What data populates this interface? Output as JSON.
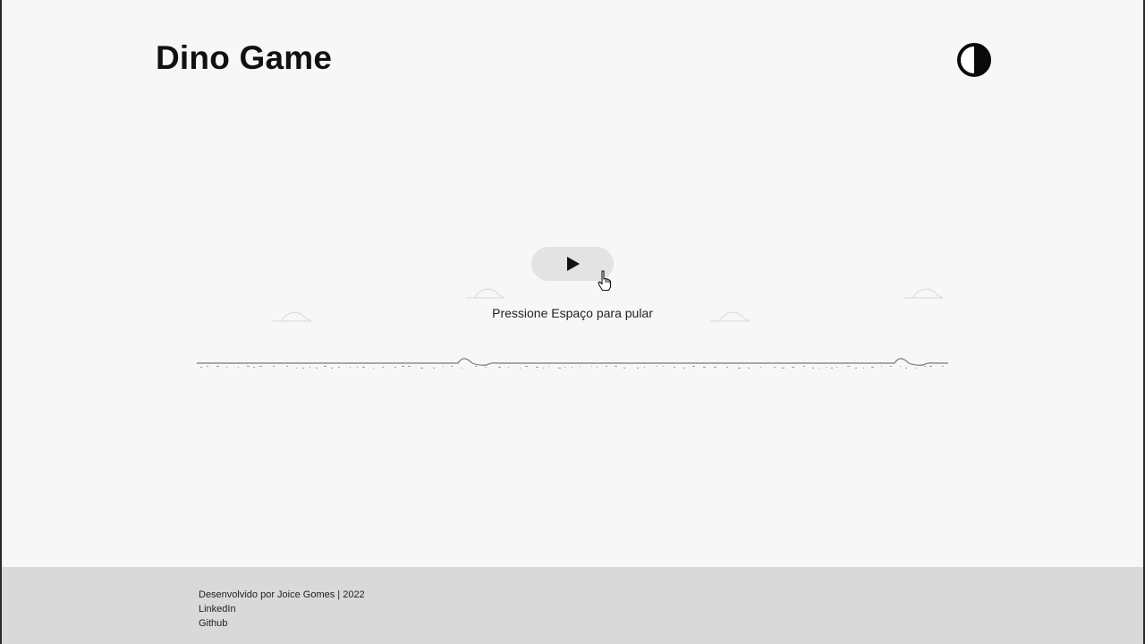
{
  "header": {
    "title": "Dino Game",
    "theme_toggle_icon": "contrast-icon"
  },
  "game": {
    "play_icon": "play-icon",
    "cursor_icon": "hand-pointer-icon",
    "instruction": "Pressione Espaço para pular"
  },
  "footer": {
    "credit": "Desenvolvido por Joice Gomes | 2022",
    "linkedin": "LinkedIn",
    "github": "Github"
  },
  "colors": {
    "background": "#f7f7f7",
    "footer_background": "#d9d9d9",
    "play_button": "#e3e3e3",
    "text": "#1a1a1a"
  }
}
